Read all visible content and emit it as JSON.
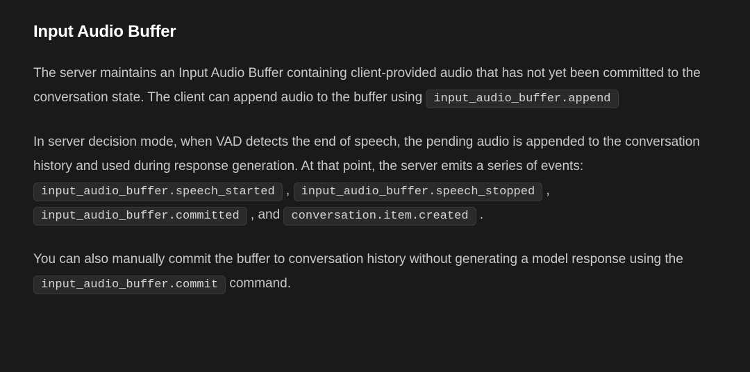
{
  "heading": "Input Audio Buffer",
  "para1": {
    "text_before_code": "The server maintains an Input Audio Buffer containing client-provided audio that has not yet been committed to the conversation state. The client can append audio to the buffer using ",
    "code1": "input_audio_buffer.append"
  },
  "para2": {
    "text_before": "In server decision mode, when VAD detects the end of speech, the pending audio is appended to the conversation history and used during response generation. At that point, the server emits a series of events: ",
    "code1": "input_audio_buffer.speech_started",
    "sep1": " , ",
    "code2": "input_audio_buffer.speech_stopped",
    "sep2": " , ",
    "code3": "input_audio_buffer.committed",
    "sep3": " , and ",
    "code4": "conversation.item.created",
    "sep4": " ."
  },
  "para3": {
    "text_before": "You can also manually commit the buffer to conversation history without generating a model response using the ",
    "code1": "input_audio_buffer.commit",
    "text_after": " command."
  }
}
